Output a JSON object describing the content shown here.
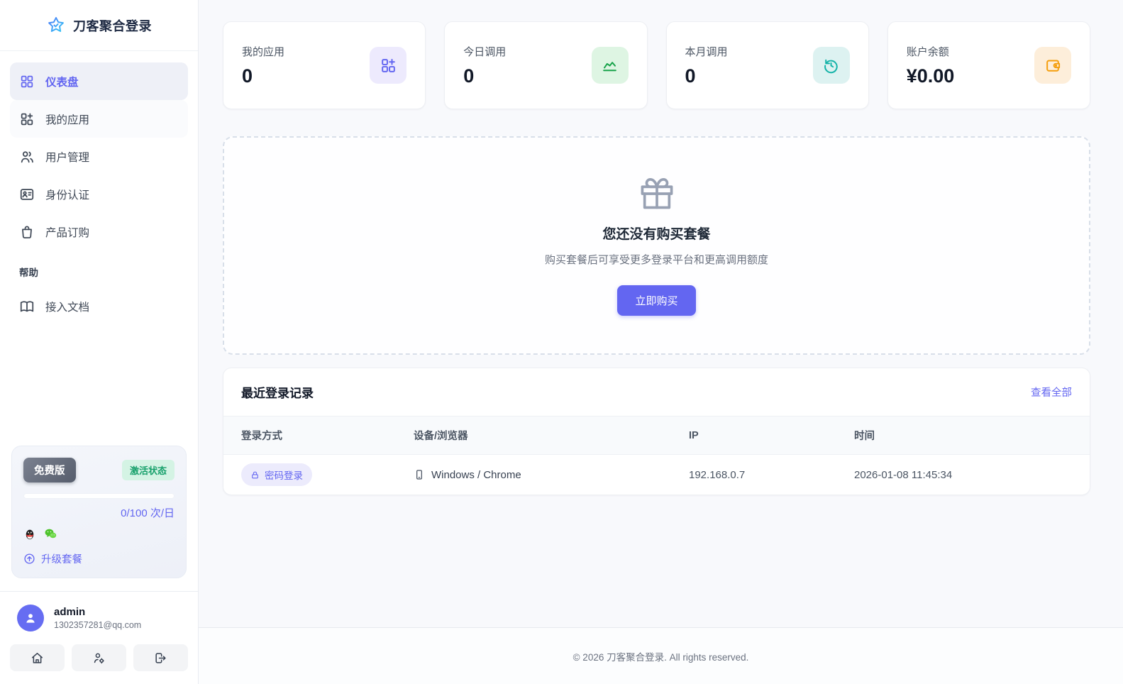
{
  "brand": {
    "name": "刀客聚合登录",
    "logo_icon": "star-check-icon"
  },
  "colors": {
    "accent": "#6366f1",
    "success": "#10b981",
    "teal": "#14b8a6",
    "orange": "#f59e0b"
  },
  "sidebar": {
    "items": [
      {
        "label": "仪表盘",
        "icon": "dashboard-grid-icon",
        "active": true
      },
      {
        "label": "我的应用",
        "icon": "grid-plus-icon",
        "active": false
      },
      {
        "label": "用户管理",
        "icon": "users-icon",
        "active": false
      },
      {
        "label": "身份认证",
        "icon": "id-card-icon",
        "active": false
      },
      {
        "label": "产品订购",
        "icon": "shopping-bag-icon",
        "active": false
      }
    ],
    "section_label": "帮助",
    "docs_item": {
      "label": "接入文档",
      "icon": "book-open-icon"
    }
  },
  "plan_card": {
    "plan_badge": "免费版",
    "status_badge": "激活状态",
    "quota": "0/100 次/日",
    "quota_used_percent": 0,
    "platform_icons": [
      "qq-icon",
      "wechat-icon"
    ],
    "upgrade_label": "升级套餐",
    "upgrade_icon": "arrow-up-circle-icon"
  },
  "user": {
    "name": "admin",
    "email": "1302357281@qq.com"
  },
  "quick_actions": [
    {
      "icon": "home-icon"
    },
    {
      "icon": "user-gear-icon"
    },
    {
      "icon": "logout-icon"
    }
  ],
  "stats": [
    {
      "label": "我的应用",
      "value": "0",
      "icon": "grid-plus-icon",
      "color": "#6366f1"
    },
    {
      "label": "今日调用",
      "value": "0",
      "icon": "chart-line-icon",
      "color": "#16a34a"
    },
    {
      "label": "本月调用",
      "value": "0",
      "icon": "history-clock-icon",
      "color": "#14b8a6"
    },
    {
      "label": "账户余额",
      "value": "¥0.00",
      "icon": "wallet-icon",
      "color": "#f59e0b"
    }
  ],
  "empty_state": {
    "icon": "gift-icon",
    "title": "您还没有购买套餐",
    "subtitle": "购买套餐后可享受更多登录平台和更高调用额度",
    "button_label": "立即购买"
  },
  "login_records": {
    "title": "最近登录记录",
    "view_all_label": "查看全部",
    "columns": [
      "登录方式",
      "设备/浏览器",
      "IP",
      "时间"
    ],
    "rows": [
      {
        "method": "密码登录",
        "method_icon": "lock-icon",
        "device": "Windows / Chrome",
        "device_icon": "smartphone-icon",
        "ip": "192.168.0.7",
        "time": "2026-01-08 11:45:34"
      }
    ]
  },
  "footer": {
    "copyright": "© 2026 刀客聚合登录. All rights reserved."
  }
}
